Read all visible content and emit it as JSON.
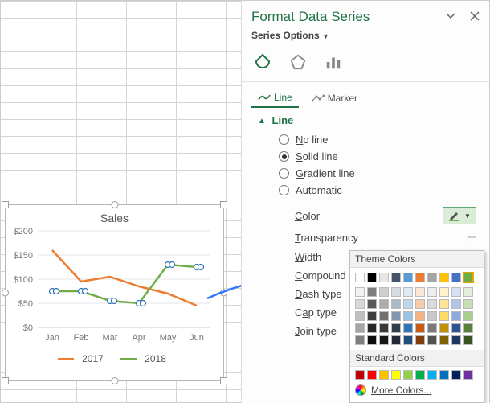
{
  "pane": {
    "title": "Format Data Series",
    "series_options_label": "Series Options",
    "tabs": {
      "line": "Line",
      "marker": "Marker"
    },
    "section_line": "Line",
    "radios": {
      "no_line": "No line",
      "solid_line": "Solid line",
      "gradient_line": "Gradient line",
      "automatic": "Automatic"
    },
    "props": {
      "color": "Color",
      "transparency": "Transparency",
      "width": "Width",
      "compound": "Compound type",
      "dash": "Dash type",
      "cap": "Cap type",
      "join": "Join type"
    }
  },
  "flyout": {
    "theme_label": "Theme Colors",
    "standard_label": "Standard Colors",
    "more_label": "More Colors...",
    "theme_row1": [
      "#ffffff",
      "#000000",
      "#e7e6e6",
      "#44546a",
      "#5b9bd5",
      "#ed7d31",
      "#a5a5a5",
      "#ffc000",
      "#4472c4",
      "#70ad47"
    ],
    "theme_shades": [
      [
        "#f2f2f2",
        "#7f7f7f",
        "#d0cece",
        "#d6dce4",
        "#deebf6",
        "#fbe5d5",
        "#ededed",
        "#fff2cc",
        "#d9e2f3",
        "#e2efd9"
      ],
      [
        "#d8d8d8",
        "#595959",
        "#aeabab",
        "#adb9ca",
        "#bdd7ee",
        "#f7cbac",
        "#dbdbdb",
        "#fee599",
        "#b4c6e7",
        "#c5e0b3"
      ],
      [
        "#bfbfbf",
        "#3f3f3f",
        "#757070",
        "#8496b0",
        "#9cc3e5",
        "#f4b183",
        "#c9c9c9",
        "#ffd965",
        "#8eaadb",
        "#a8d08d"
      ],
      [
        "#a5a5a5",
        "#262626",
        "#3a3838",
        "#323f4f",
        "#2e75b5",
        "#c55a11",
        "#7b7b7b",
        "#bf9000",
        "#2f5496",
        "#538135"
      ],
      [
        "#7f7f7f",
        "#0c0c0c",
        "#171616",
        "#222a35",
        "#1e4e79",
        "#833c0b",
        "#525252",
        "#7f6000",
        "#1f3864",
        "#375623"
      ]
    ],
    "standard": [
      "#c00000",
      "#ff0000",
      "#ffc000",
      "#ffff00",
      "#92d050",
      "#00b050",
      "#00b0f0",
      "#0070c0",
      "#002060",
      "#7030a0"
    ]
  },
  "chart": {
    "title": "Sales",
    "legend": {
      "s1": "2017",
      "s2": "2018"
    },
    "xlabels": [
      "Jan",
      "Feb",
      "Mar",
      "Apr",
      "May",
      "Jun"
    ],
    "ylabels": [
      "$200",
      "$150",
      "$100",
      "$50",
      "$0"
    ],
    "colors": {
      "s1": "#ed7d31",
      "s2": "#70ad47"
    }
  },
  "chart_data": {
    "type": "line",
    "title": "Sales",
    "categories": [
      "Jan",
      "Feb",
      "Mar",
      "Apr",
      "May",
      "Jun"
    ],
    "series": [
      {
        "name": "2017",
        "values": [
          160,
          95,
          105,
          85,
          70,
          45
        ]
      },
      {
        "name": "2018",
        "values": [
          75,
          75,
          55,
          50,
          130,
          125
        ]
      }
    ],
    "ylabel": "",
    "xlabel": "",
    "ylim": [
      0,
      200
    ]
  }
}
